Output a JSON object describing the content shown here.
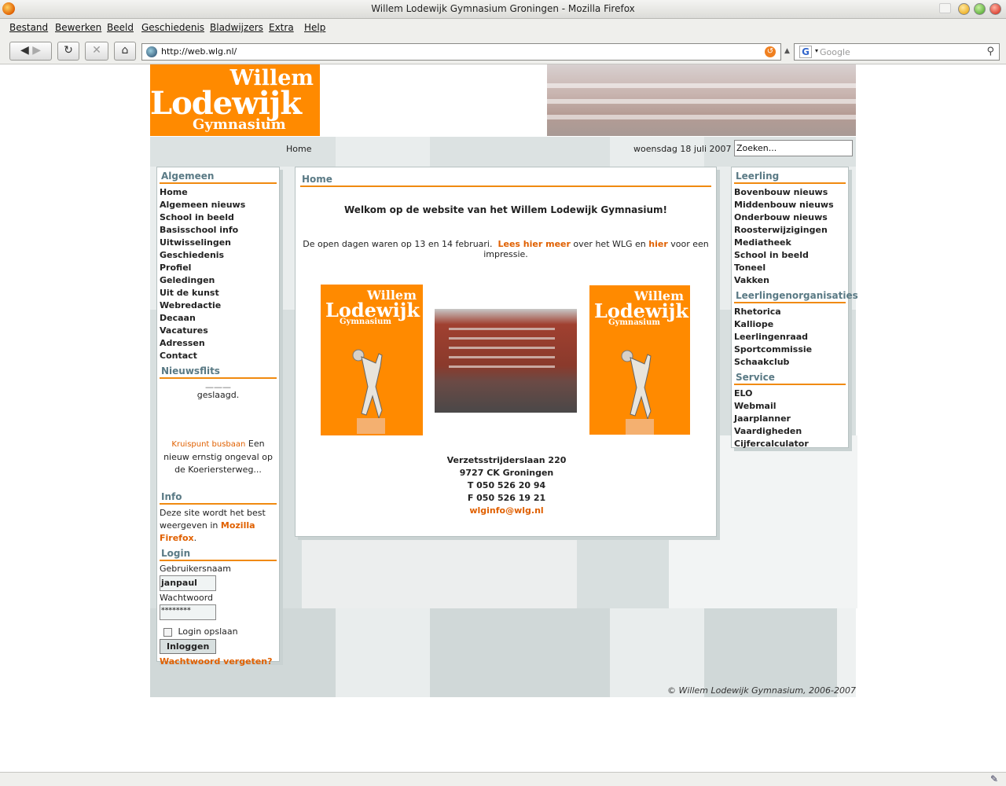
{
  "browser": {
    "window_title": "Willem Lodewijk Gymnasium Groningen - Mozilla Firefox",
    "menu": [
      "Bestand",
      "Bewerken",
      "Beeld",
      "Geschiedenis",
      "Bladwijzers",
      "Extra",
      "Help"
    ],
    "url": "http://web.wlg.nl/",
    "search_placeholder": "Google"
  },
  "site": {
    "logo": {
      "line1": "Willem",
      "line2": "Lodewijk",
      "line3": "Gymnasium"
    },
    "breadcrumb": "Home",
    "date": "woensdag 18 juli 2007",
    "search_value": "Zoeken...",
    "footer": "© Willem Lodewijk Gymnasium, 2006-2007"
  },
  "left": {
    "algemeen_title": "Algemeen",
    "algemeen_items": [
      "Home",
      "Algemeen nieuws",
      "School in beeld",
      "Basisschool info",
      "Uitwisselingen",
      "Geschiedenis",
      "Profiel",
      "Geledingen",
      "Uit de kunst",
      "Webredactie",
      "Decaan",
      "Vacatures",
      "Adressen",
      "Contact"
    ],
    "nieuwsflits_title": "Nieuwsflits",
    "flash1": "geslaagd.",
    "flash2_link": "Kruispunt busbaan",
    "flash2_text": "Een nieuw ernstig ongeval op de Koeriersterweg...",
    "info_title": "Info",
    "info_text": "Deze site wordt het best weergeven in",
    "info_link": "Mozilla Firefox",
    "login_title": "Login",
    "user_label": "Gebruikersnaam",
    "user_value": "janpaul",
    "pass_label": "Wachtwoord",
    "pass_value": "********",
    "remember_label": "Login opslaan",
    "login_button": "Inloggen",
    "forgot": "Wachtwoord vergeten?"
  },
  "main": {
    "title": "Home",
    "welcome": "Welkom op de website van het Willem Lodewijk Gymnasium!",
    "open_text1": "De open dagen waren op 13 en 14 februari.",
    "open_link1": "Lees hier meer",
    "open_text2": "over het WLG en",
    "open_link2": "hier",
    "open_text3": "voor een impressie.",
    "address": [
      "Verzetsstrijderslaan 220",
      "9727 CK Groningen",
      "T 050 526 20 94",
      "F 050 526 19 21"
    ],
    "email": "wlginfo@wlg.nl"
  },
  "right": {
    "leerling_title": "Leerling",
    "leerling_items": [
      "Bovenbouw nieuws",
      "Middenbouw nieuws",
      "Onderbouw nieuws",
      "Roosterwijzigingen",
      "Mediatheek",
      "School in beeld",
      "Toneel",
      "Vakken"
    ],
    "org_title": "Leerlingenorganisaties",
    "org_items": [
      "Rhetorica",
      "Kalliope",
      "Leerlingenraad",
      "Sportcommissie",
      "Schaakclub"
    ],
    "service_title": "Service",
    "service_items": [
      "ELO",
      "Webmail",
      "Jaarplanner",
      "Vaardigheden",
      "Cijfercalculator"
    ]
  },
  "colors": {
    "accent": "#ff8a00",
    "heading": "#5a7a85",
    "link": "#e06000"
  }
}
